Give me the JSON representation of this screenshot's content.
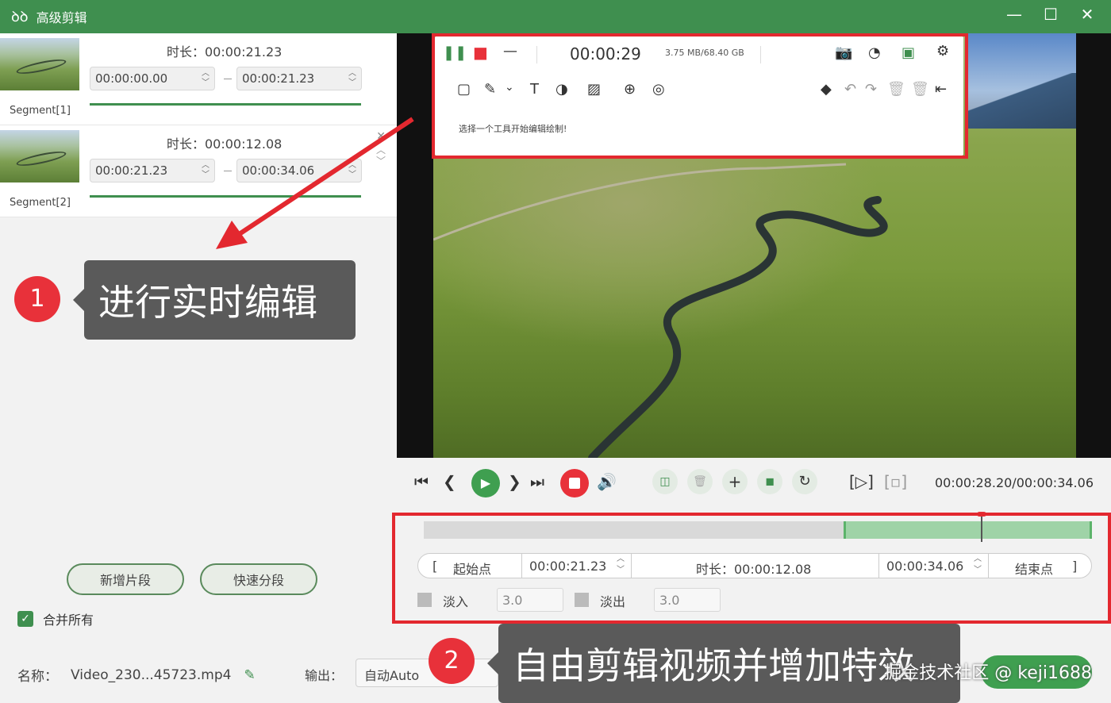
{
  "window": {
    "title": "高级剪辑",
    "controls": [
      "—",
      "☐",
      "✕"
    ]
  },
  "segments": [
    {
      "label": "Segment[1]",
      "duration": "时长：00:00:21.23",
      "start": "00:00:00.00",
      "end": "00:00:21.23"
    },
    {
      "label": "Segment[2]",
      "duration": "时长：00:00:12.08",
      "start": "00:00:21.23",
      "end": "00:00:34.06"
    }
  ],
  "left_actions": {
    "add_segment": "新增片段",
    "quick_split": "快速分段",
    "merge_all": "合并所有"
  },
  "file": {
    "name_label": "名称：",
    "name_value": "Video_230...45723.mp4",
    "output_label": "输出：",
    "output_value": "自动Auto"
  },
  "recorder": {
    "time": "00:00:29",
    "size": "3.75 MB/68.40 GB",
    "hint": "选择一个工具开始编辑绘制!"
  },
  "player": {
    "time_readout": "00:00:28.20/00:00:34.06"
  },
  "timeline": {
    "start_point_label": "起始点",
    "start_value": "00:00:21.23",
    "duration": "时长：00:00:12.08",
    "end_value": "00:00:34.06",
    "end_point_label": "结束点",
    "fade_in_label": "淡入",
    "fade_in_value": "3.0",
    "fade_out_label": "淡出",
    "fade_out_value": "3.0"
  },
  "annotations": {
    "badge1": "1",
    "callout1": "进行实时编辑",
    "badge2": "2",
    "callout2": "自由剪辑视频并增加特效",
    "watermark": "掘金技术社区 @ keji1688"
  },
  "colors": {
    "brand_green": "#3f8f4f",
    "annotation_red": "#e3282f",
    "callout_gray": "#5a5a5a"
  }
}
